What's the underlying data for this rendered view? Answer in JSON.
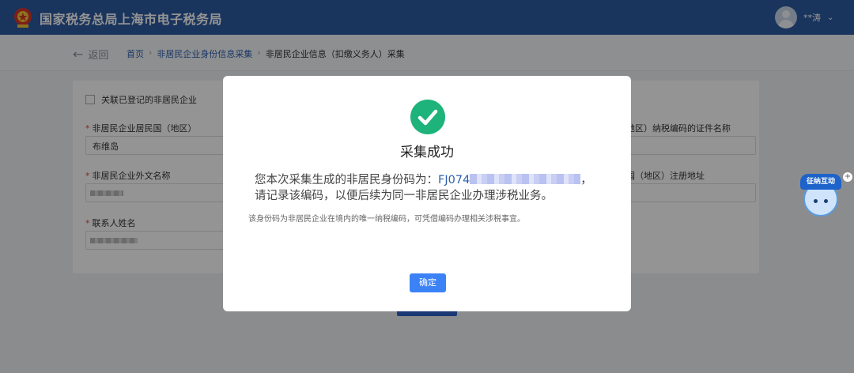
{
  "header": {
    "title": "国家税务总局上海市电子税务局",
    "user_name": "**涛",
    "colors": {
      "bar": "#2c5aa0"
    }
  },
  "nav": {
    "back_label": "返回",
    "breadcrumb": [
      "首页",
      "非居民企业身份信息采集",
      "非居民企业信息（扣缴义务人）采集"
    ]
  },
  "form": {
    "link_checkbox_label": "关联已登记的非居民企业",
    "fields": [
      {
        "label": "非居民企业居民国（地区）",
        "required": true,
        "value": "布维岛"
      },
      {
        "label": "地区）纳税编码的证件名称",
        "required": false,
        "value": ""
      },
      {
        "label": "非居民企业外文名称",
        "required": true,
        "value": ""
      },
      {
        "label": "国（地区）注册地址",
        "required": false,
        "value": ""
      },
      {
        "label": "联系人姓名",
        "required": true,
        "value": ""
      }
    ]
  },
  "assistant": {
    "label": "征纳互动",
    "icon": "assistant-mascot-icon"
  },
  "dialog": {
    "title": "采集成功",
    "message_prefix": "您本次采集生成的非居民身份码为：",
    "code_visible": "FJ074",
    "message_suffix": "，请记录该编码，以便后续为同一非居民企业办理涉税业务。",
    "note": "该身份码为非居民企业在境内的唯一纳税编码，可凭借编码办理相关涉税事宜。",
    "confirm_label": "确定",
    "colors": {
      "success": "#1db37a",
      "primary": "#3b82f6"
    }
  }
}
